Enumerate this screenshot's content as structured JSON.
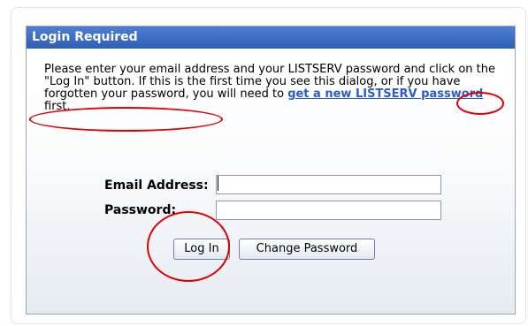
{
  "dialog": {
    "title": "Login Required",
    "intro_text_1": "Please enter your email address and your LISTSERV password and click on the \"Log In\" button. If this is the first time you see this dialog, or if you have forgotten your password, you will need to ",
    "intro_link": "get a new LISTSERV password",
    "intro_text_2": " first.",
    "email_label": "Email Address:",
    "email_value": "",
    "password_label": "Password:",
    "password_value": "",
    "login_button": "Log In",
    "change_password_button": "Change Password"
  },
  "annotations": {
    "color": "#e00000"
  }
}
